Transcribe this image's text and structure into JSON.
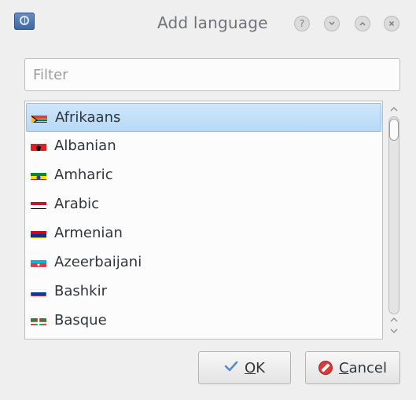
{
  "window": {
    "title": "Add language",
    "buttons": {
      "help": "?",
      "minimize": "minimize",
      "maximize": "maximize",
      "close": "close"
    }
  },
  "filter": {
    "placeholder": "Filter",
    "value": ""
  },
  "languages": {
    "selected_index": 0,
    "items": [
      {
        "label": "Afrikaans",
        "flag_icon": "south-africa-flag-icon"
      },
      {
        "label": "Albanian",
        "flag_icon": "albania-flag-icon"
      },
      {
        "label": "Amharic",
        "flag_icon": "ethiopia-flag-icon"
      },
      {
        "label": "Arabic",
        "flag_icon": "egypt-flag-icon"
      },
      {
        "label": "Armenian",
        "flag_icon": "armenia-flag-icon"
      },
      {
        "label": "Azeerbaijani",
        "flag_icon": "azerbaijan-flag-icon"
      },
      {
        "label": "Bashkir",
        "flag_icon": "russia-flag-icon"
      },
      {
        "label": "Basque",
        "flag_icon": "basque-flag-icon"
      }
    ]
  },
  "buttons": {
    "ok_label_prefix": "",
    "ok_mnemonic": "O",
    "ok_label_rest": "K",
    "cancel_mnemonic": "C",
    "cancel_label_rest": "ancel"
  },
  "colors": {
    "accent_selection": "#b7d9f7",
    "cancel_icon": "#d73b3b",
    "ok_icon": "#5b8bc7"
  }
}
